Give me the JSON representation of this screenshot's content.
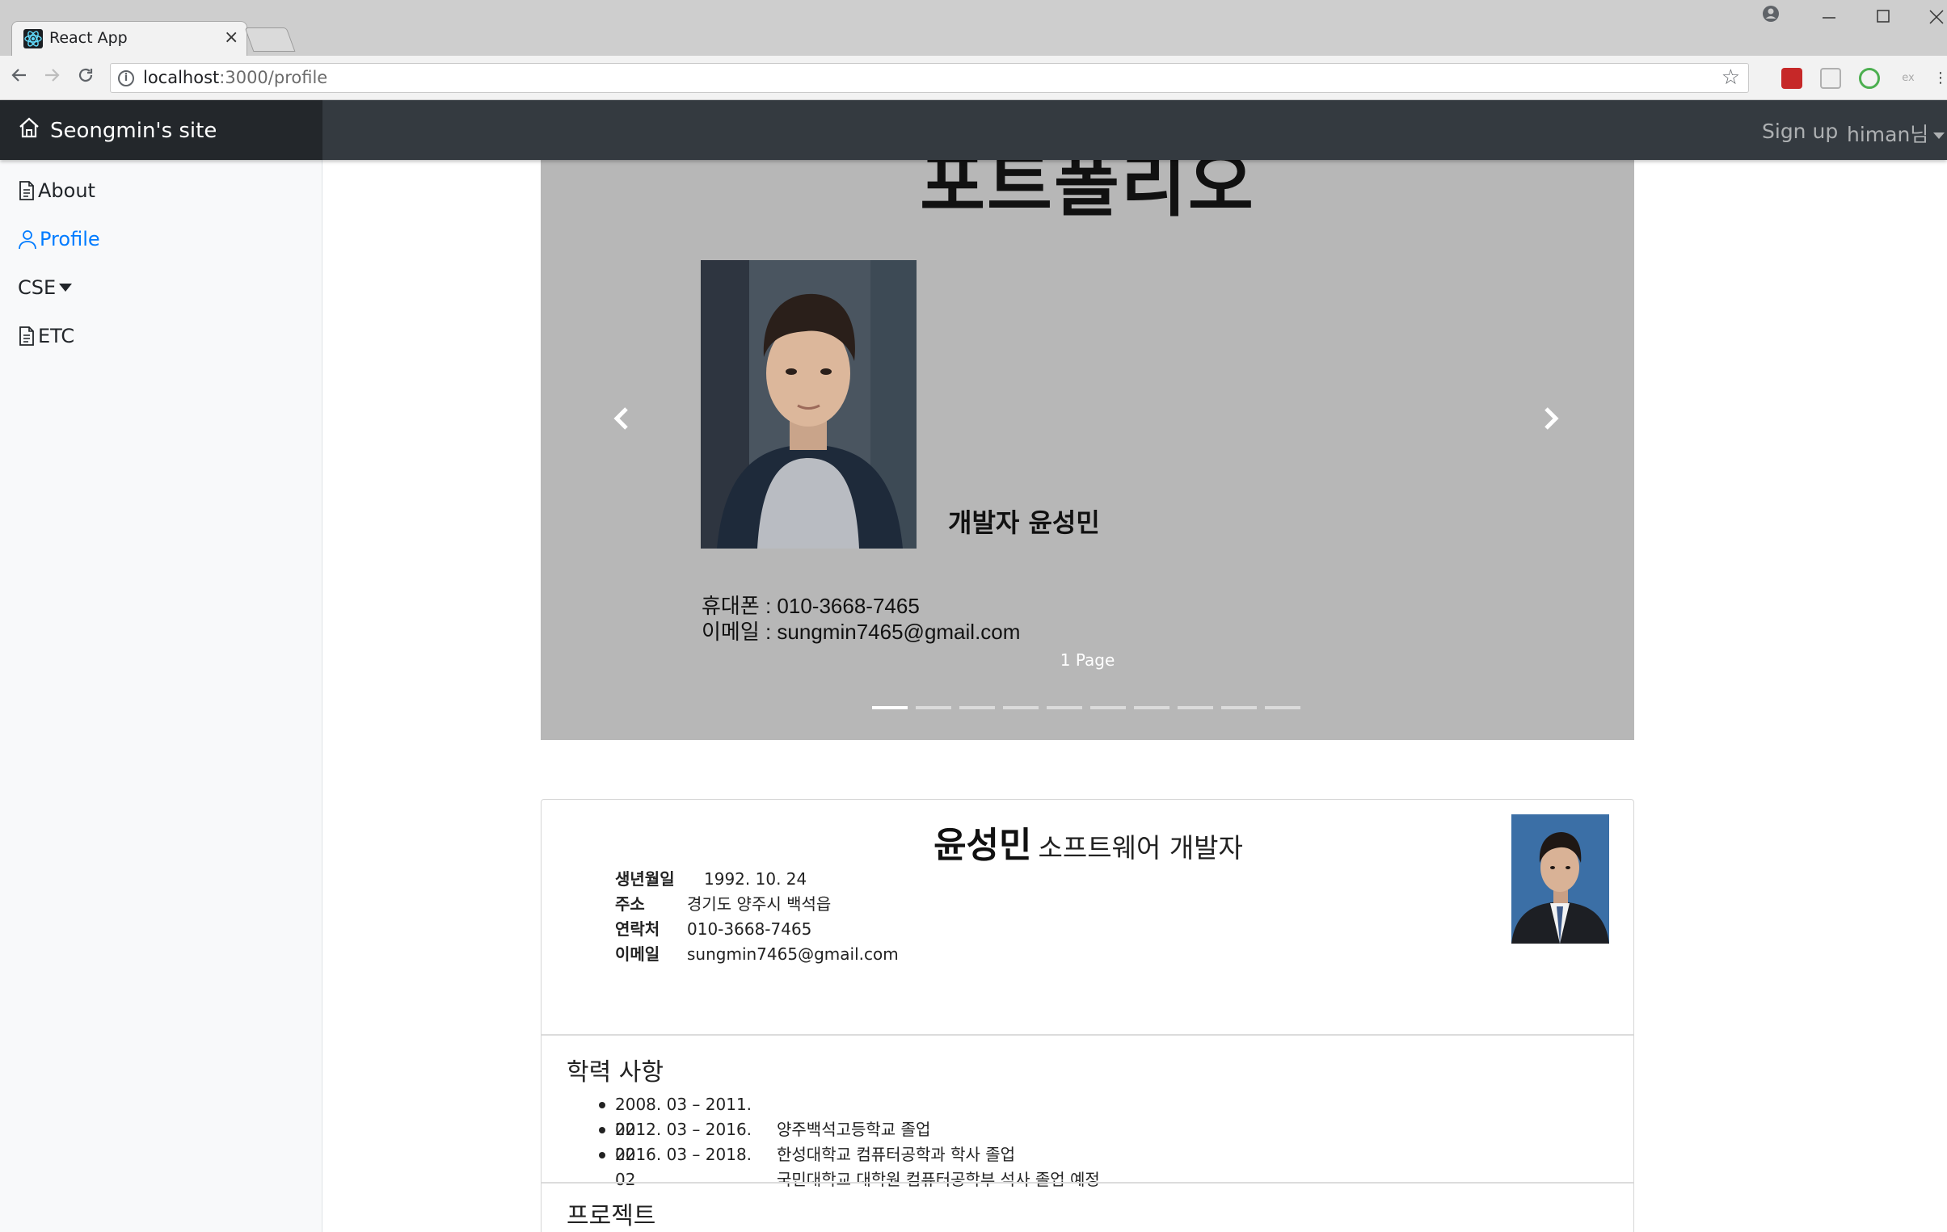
{
  "browser": {
    "tab_title": "React App",
    "tab_close": "×",
    "url_host": "localhost",
    "url_rest": ":3000/profile",
    "info_icon": "i",
    "star_icon": "☆",
    "ext_label": "ex"
  },
  "navbar": {
    "brand": "Seongmin's site",
    "signup": "Sign up",
    "user": "himan님"
  },
  "sidebar": {
    "items": [
      {
        "label": "About",
        "icon": "document-icon"
      },
      {
        "label": "Profile",
        "icon": "person-icon",
        "active": true
      },
      {
        "label": "CSE",
        "icon": "caret-down-icon"
      },
      {
        "label": "ETC",
        "icon": "document-icon"
      }
    ]
  },
  "carousel": {
    "heading": "포트폴리오",
    "role": "개발자 윤성민",
    "phone_line": "휴대폰 :  010-3668-7465",
    "email_line": "이메일 : sungmin7465@gmail.com",
    "caption": "1 Page",
    "indicator_count": 10,
    "active_index": 0
  },
  "profile": {
    "name": "윤성민",
    "job": "소프트웨어 개발자",
    "info": [
      {
        "key": "생년월일",
        "value": "1992. 10. 24"
      },
      {
        "key": "주소",
        "value": "경기도 양주시 백석읍"
      },
      {
        "key": "연락처",
        "value": "010-3668-7465"
      },
      {
        "key": "이메일",
        "value": "sungmin7465@gmail.com"
      }
    ]
  },
  "education": {
    "title": "학력 사항",
    "items": [
      {
        "period": "2008. 03 – 2011. 02",
        "desc": "양주백석고등학교 졸업"
      },
      {
        "period": "2012. 03 – 2016. 02",
        "desc": "한성대학교 컴퓨터공학과 학사 졸업"
      },
      {
        "period": "2016. 03 – 2018. 02",
        "desc": "국민대학교 대학원 컴퓨터공학부 석사 졸업 예정"
      }
    ]
  },
  "projects": {
    "title": "프로젝트"
  },
  "colors": {
    "navbar": "#343a40",
    "brand_bg": "#23272b",
    "active_link": "#007bff",
    "carousel_bg": "#b7b7b7"
  }
}
